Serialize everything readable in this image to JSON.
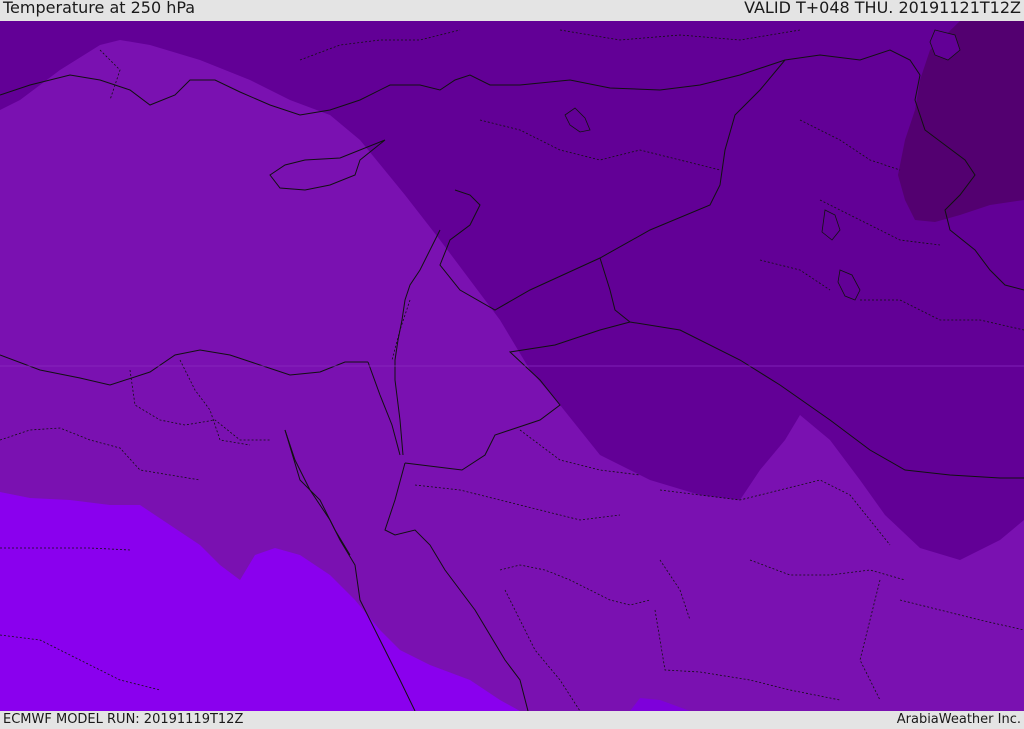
{
  "header": {
    "title": "Temperature at 250 hPa",
    "valid": "VALID T+048 THU. 20191121T12Z"
  },
  "footer": {
    "model_run": "ECMWF MODEL RUN: 20191119T12Z",
    "credit": "ArabiaWeather Inc."
  },
  "map": {
    "field": "temperature",
    "pressure_level": "250 hPa",
    "colors": {
      "band_coldest": "#530070",
      "band_cold": "#620096",
      "band_mid": "#7a11b1",
      "band_warm": "#7e00db",
      "band_warmest": "#8a00ee",
      "border_line": "#111111"
    }
  }
}
